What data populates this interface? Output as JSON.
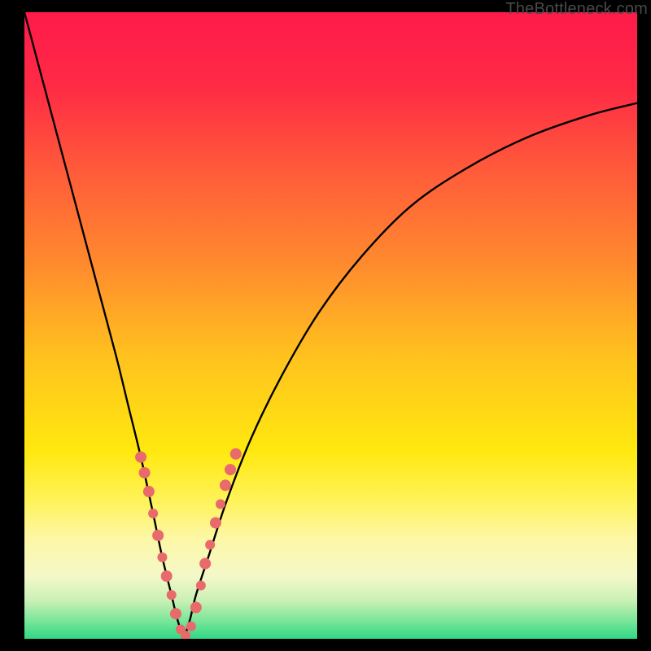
{
  "watermark": "TheBottleneck.com",
  "chart_data": {
    "type": "line",
    "title": "",
    "xlabel": "",
    "ylabel": "",
    "xlim": [
      0,
      100
    ],
    "ylim": [
      0,
      100
    ],
    "gradient_stops": [
      {
        "offset": 0.0,
        "color": "#ff1a4a"
      },
      {
        "offset": 0.12,
        "color": "#ff2b45"
      },
      {
        "offset": 0.25,
        "color": "#ff5a3a"
      },
      {
        "offset": 0.4,
        "color": "#ff8a2e"
      },
      {
        "offset": 0.55,
        "color": "#ffc21e"
      },
      {
        "offset": 0.7,
        "color": "#ffe80f"
      },
      {
        "offset": 0.78,
        "color": "#fff35a"
      },
      {
        "offset": 0.84,
        "color": "#fdf7a6"
      },
      {
        "offset": 0.9,
        "color": "#f4f8c8"
      },
      {
        "offset": 0.94,
        "color": "#c8f0b4"
      },
      {
        "offset": 0.97,
        "color": "#7de69a"
      },
      {
        "offset": 1.0,
        "color": "#2fd885"
      }
    ],
    "series": [
      {
        "name": "bottleneck-curve",
        "x": [
          0,
          3,
          6,
          9,
          12,
          15,
          17,
          19,
          21,
          22.5,
          24,
          25,
          26,
          27,
          28,
          30,
          33,
          37,
          42,
          48,
          55,
          63,
          72,
          82,
          92,
          100
        ],
        "y": [
          100,
          89,
          78,
          67,
          56,
          45,
          37,
          29,
          20,
          13,
          7,
          3,
          0.5,
          3,
          7,
          13,
          22,
          32,
          42,
          52,
          61,
          69,
          75,
          80,
          83.5,
          85.5
        ]
      }
    ],
    "markers": {
      "name": "highlight-dots",
      "color": "#e86a6a",
      "points": [
        {
          "x": 19.0,
          "y": 29.0,
          "r": 7
        },
        {
          "x": 19.6,
          "y": 26.5,
          "r": 7
        },
        {
          "x": 20.3,
          "y": 23.5,
          "r": 7
        },
        {
          "x": 21.0,
          "y": 20.0,
          "r": 6
        },
        {
          "x": 21.8,
          "y": 16.5,
          "r": 7
        },
        {
          "x": 22.5,
          "y": 13.0,
          "r": 6
        },
        {
          "x": 23.2,
          "y": 10.0,
          "r": 7
        },
        {
          "x": 24.0,
          "y": 7.0,
          "r": 6
        },
        {
          "x": 24.7,
          "y": 4.0,
          "r": 7
        },
        {
          "x": 25.5,
          "y": 1.5,
          "r": 6
        },
        {
          "x": 26.3,
          "y": 0.5,
          "r": 6
        },
        {
          "x": 27.2,
          "y": 2.0,
          "r": 6
        },
        {
          "x": 28.0,
          "y": 5.0,
          "r": 7
        },
        {
          "x": 28.8,
          "y": 8.5,
          "r": 6
        },
        {
          "x": 29.5,
          "y": 12.0,
          "r": 7
        },
        {
          "x": 30.3,
          "y": 15.0,
          "r": 6
        },
        {
          "x": 31.2,
          "y": 18.5,
          "r": 7
        },
        {
          "x": 32.0,
          "y": 21.5,
          "r": 6
        },
        {
          "x": 32.8,
          "y": 24.5,
          "r": 7
        },
        {
          "x": 33.6,
          "y": 27.0,
          "r": 7
        },
        {
          "x": 34.5,
          "y": 29.5,
          "r": 7
        }
      ]
    }
  }
}
